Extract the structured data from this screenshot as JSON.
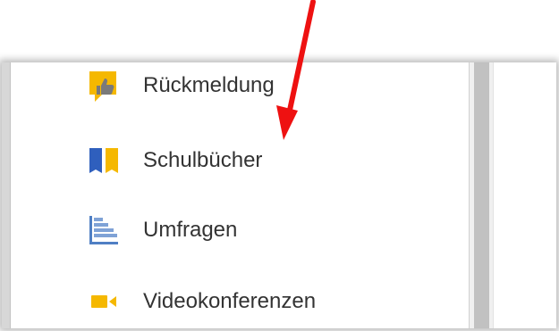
{
  "menu": {
    "items": [
      {
        "label": "Rückmeldung",
        "icon": "feedback-thumbs-up-icon"
      },
      {
        "label": "Schulbücher",
        "icon": "textbook-icon"
      },
      {
        "label": "Umfragen",
        "icon": "survey-chart-icon"
      },
      {
        "label": "Videokonferenzen",
        "icon": "video-camera-icon"
      }
    ]
  },
  "annotation": {
    "arrow_color": "#ee1111",
    "icon": "red-arrow-icon"
  },
  "colors": {
    "yellow": "#f5b800",
    "blue": "#2f5fbd",
    "survey_blue": "#4f7fc4",
    "text": "#333333"
  }
}
